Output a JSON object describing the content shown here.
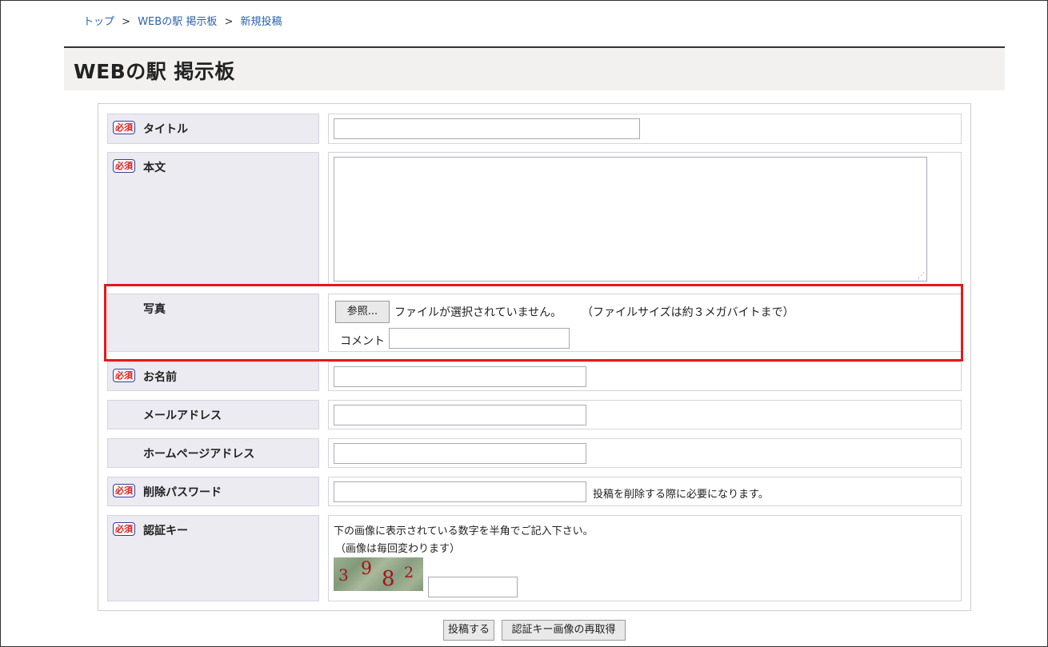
{
  "breadcrumb": {
    "items": [
      "トップ",
      "WEBの駅 掲示板",
      "新規投稿"
    ],
    "separator": ">"
  },
  "page": {
    "title": "WEBの駅 掲示板"
  },
  "required_badge": "必須",
  "fields": {
    "title": {
      "label": "タイトル",
      "value": ""
    },
    "body": {
      "label": "本文",
      "value": ""
    },
    "photo": {
      "label": "写真",
      "browse_label": "参照...",
      "file_status": "ファイルが選択されていません。",
      "note": "（ファイルサイズは約３メガバイトまで）",
      "comment_label": "コメント",
      "comment_value": ""
    },
    "name": {
      "label": "お名前",
      "value": ""
    },
    "email": {
      "label": "メールアドレス",
      "value": ""
    },
    "homepage": {
      "label": "ホームページアドレス",
      "value": ""
    },
    "delete_password": {
      "label": "削除パスワード",
      "value": "",
      "hint": "投稿を削除する際に必要になります。"
    },
    "auth_key": {
      "label": "認証キー",
      "instruction": "下の画像に表示されている数字を半角でご記入下さい。",
      "sub_instruction": "（画像は毎回変わります）",
      "captcha_digits": [
        "3",
        "9",
        "8",
        "2"
      ],
      "value": ""
    }
  },
  "buttons": {
    "submit": "投稿する",
    "refresh_captcha": "認証キー画像の再取得"
  },
  "colors": {
    "required": "#d61f1f",
    "highlight": "#e21a1a",
    "link": "#2a62a8",
    "label_bg": "#ecebf2"
  }
}
